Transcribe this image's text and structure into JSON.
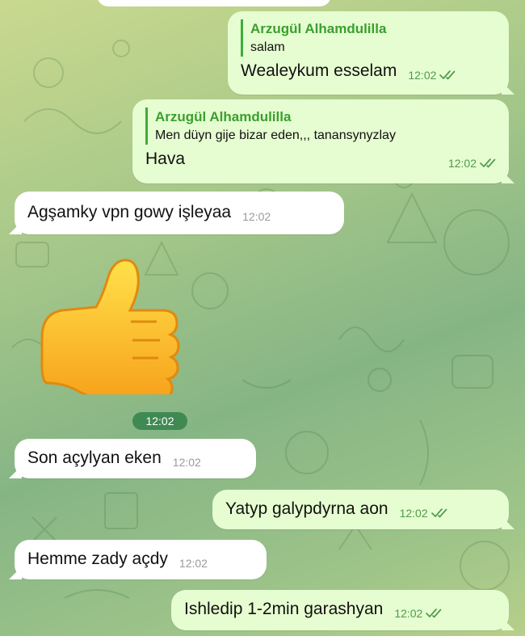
{
  "colors": {
    "accent_green": "#3a9f2f",
    "outgoing_bubble": "#e6fdd1",
    "incoming_bubble": "#ffffff",
    "time_pill": "#3f8a53"
  },
  "messages": [
    {
      "direction": "out",
      "reply_name": "Arzugül Alhamdulilla",
      "reply_text": "salam",
      "text": "Wealeykum esselam",
      "time": "12:02",
      "status_icon": "double-check-icon"
    },
    {
      "direction": "out",
      "reply_name": "Arzugül Alhamdulilla",
      "reply_text": "Men düyn gije bizar eden,,, tanansynyzlay",
      "text": "Hava",
      "time": "12:02",
      "status_icon": "double-check-icon"
    },
    {
      "direction": "in",
      "text": "Agşamky vpn gowy işleyaa",
      "time": "12:02"
    },
    {
      "direction": "in",
      "sticker": "thumbs-up-icon",
      "time": "12:02"
    },
    {
      "direction": "in",
      "text": "Son açylyan eken",
      "time": "12:02"
    },
    {
      "direction": "out",
      "text": "Yatyp galypdyrna aon",
      "time": "12:02",
      "status_icon": "double-check-icon"
    },
    {
      "direction": "in",
      "text": "Hemme zady açdy",
      "time": "12:02"
    },
    {
      "direction": "out",
      "text": "Ishledip 1-2min garashyan",
      "time": "12:02",
      "status_icon": "double-check-icon"
    }
  ]
}
